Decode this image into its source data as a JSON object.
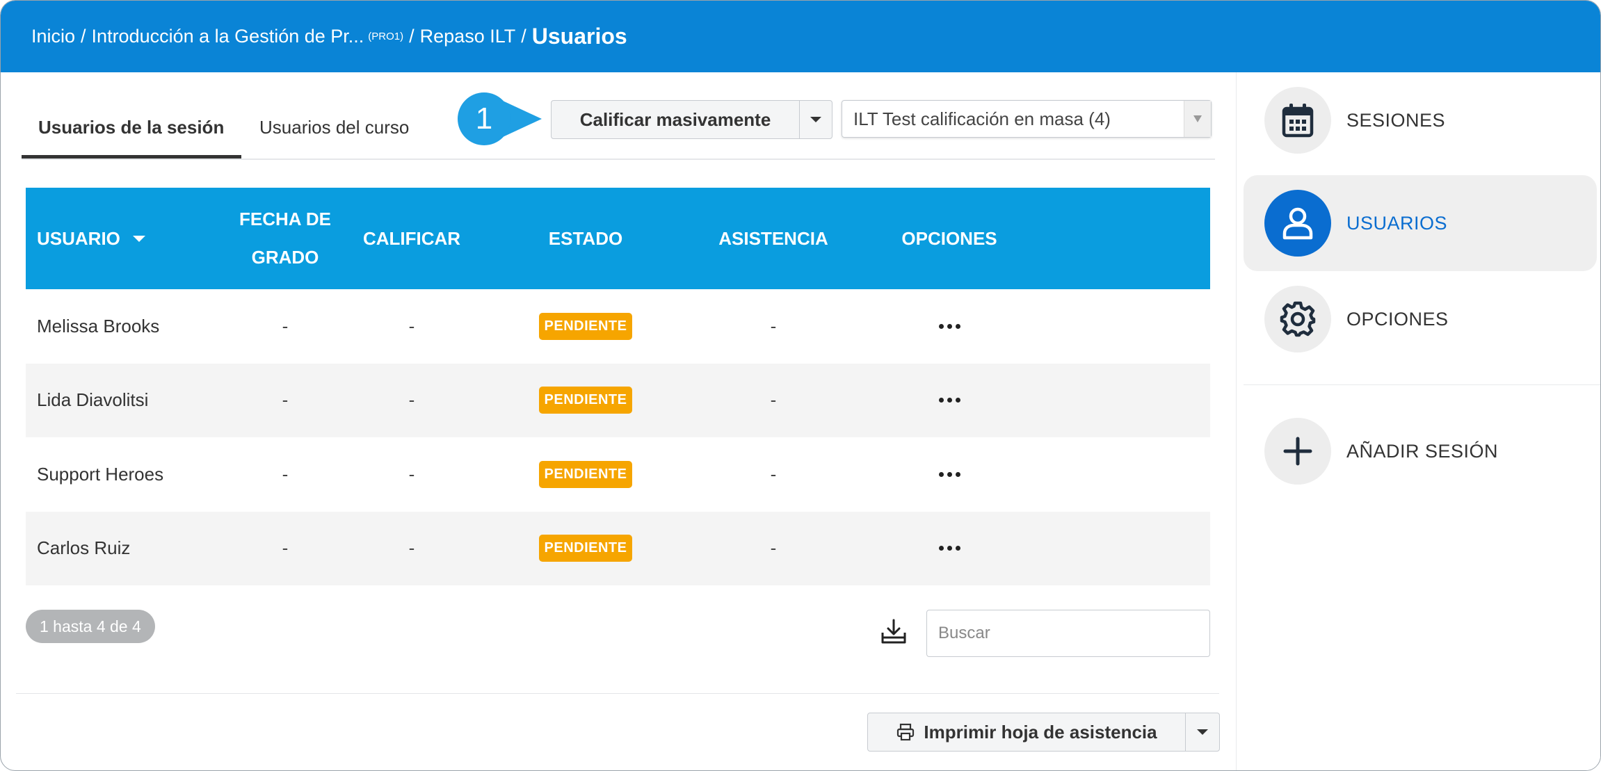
{
  "breadcrumb": {
    "items": [
      "Inicio",
      "Introducción a la Gestión de Pr...",
      "Repaso ILT"
    ],
    "course_code": "(PRO1)",
    "separator": "/",
    "current": "Usuarios"
  },
  "tabs": {
    "session_users": "Usuarios de la sesión",
    "course_users": "Usuarios del curso"
  },
  "step_badge": "1",
  "toolbar": {
    "bulk_grade_label": "Calificar masivamente",
    "session_select_value": "ILT Test calificación en masa (4)"
  },
  "table": {
    "columns": {
      "user": "USUARIO",
      "grade_date_line1": "FECHA DE",
      "grade_date_line2": "GRADO",
      "grade": "CALIFICAR",
      "status": "ESTADO",
      "attendance": "ASISTENCIA",
      "options": "OPCIONES"
    },
    "rows": [
      {
        "name": "Melissa Brooks",
        "grade_date": "-",
        "grade": "-",
        "status": "PENDIENTE",
        "attendance": "-"
      },
      {
        "name": "Lida Diavolitsi",
        "grade_date": "-",
        "grade": "-",
        "status": "PENDIENTE",
        "attendance": "-"
      },
      {
        "name": "Support Heroes",
        "grade_date": "-",
        "grade": "-",
        "status": "PENDIENTE",
        "attendance": "-"
      },
      {
        "name": "Carlos Ruiz",
        "grade_date": "-",
        "grade": "-",
        "status": "PENDIENTE",
        "attendance": "-"
      }
    ]
  },
  "pagination": {
    "summary": "1 hasta 4 de 4"
  },
  "search": {
    "placeholder": "Buscar"
  },
  "print_button": {
    "label": "Imprimir hoja de asistencia"
  },
  "sidebar": {
    "items": [
      {
        "label": "SESIONES",
        "icon": "calendar-icon",
        "active": false
      },
      {
        "label": "USUARIOS",
        "icon": "user-icon",
        "active": true
      },
      {
        "label": "OPCIONES",
        "icon": "gear-icon",
        "active": false
      }
    ],
    "add_session": {
      "label": "AÑADIR SESIÓN",
      "icon": "plus-icon"
    }
  },
  "colors": {
    "header_bg": "#0a84d6",
    "table_header_bg": "#0a9ddf",
    "status_pending": "#f6a500",
    "active_accent": "#0a6dd0",
    "step_badge": "#1f9fe3"
  }
}
